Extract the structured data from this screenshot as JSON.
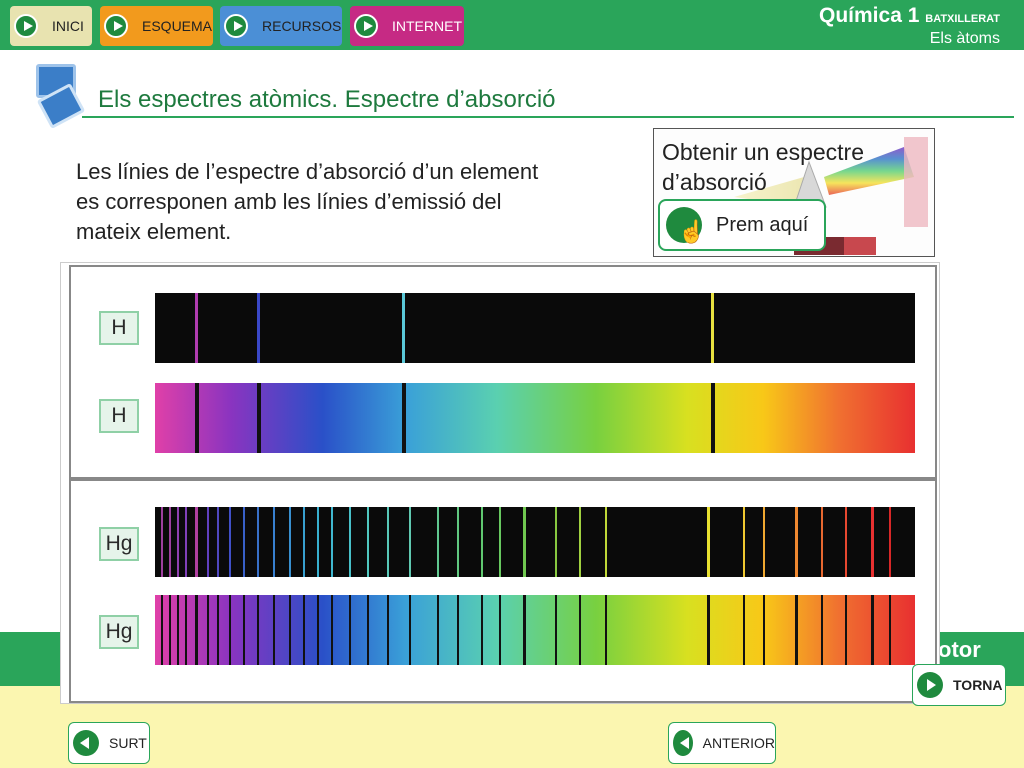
{
  "nav": {
    "inici": "INICI",
    "esquema": "ESQUEMA",
    "recursos": "RECURSOS",
    "internet": "INTERNET"
  },
  "brand": {
    "course": "Química 1",
    "level": "BATXILLERAT",
    "unit": "Els àtoms"
  },
  "page": {
    "title": "Els espectres atòmics. Espectre d’absorció",
    "body": "Les línies de l’espectre d’absorció d’un element es corresponen amb les línies d’emissió del mateix element."
  },
  "link_box": {
    "title": "Obtenir un espectre d’absorció",
    "button": "Prem aquí"
  },
  "figure": {
    "labels": [
      "H",
      "H",
      "Hg",
      "Hg"
    ]
  },
  "footer": {
    "publisher": "otor",
    "torna": "TORNA",
    "surt": "SURT",
    "anterior": "ANTERIOR"
  },
  "colors": {
    "primary_green": "#2aa55a",
    "yellow_bg": "#fbf6b0",
    "esquema": "#f29a1d",
    "recursos": "#4b8fd6",
    "internet": "#c62a84"
  }
}
